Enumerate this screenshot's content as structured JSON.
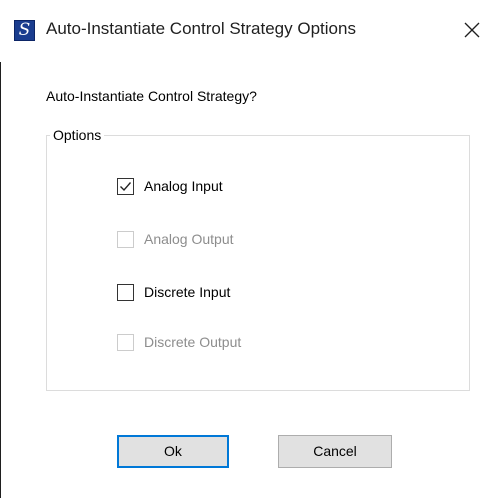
{
  "window": {
    "title": "Auto-Instantiate Control Strategy Options",
    "icon_glyph": "S",
    "icon_name": "app-icon",
    "accent": "#0078d7"
  },
  "question": "Auto-Instantiate Control Strategy?",
  "options_group": {
    "label": "Options",
    "items": [
      {
        "label": "Analog Input",
        "checked": true,
        "enabled": true
      },
      {
        "label": "Analog Output",
        "checked": false,
        "enabled": false
      },
      {
        "label": "Discrete Input",
        "checked": false,
        "enabled": true
      },
      {
        "label": "Discrete Output",
        "checked": false,
        "enabled": false
      }
    ]
  },
  "buttons": {
    "ok_label": "Ok",
    "cancel_label": "Cancel"
  }
}
